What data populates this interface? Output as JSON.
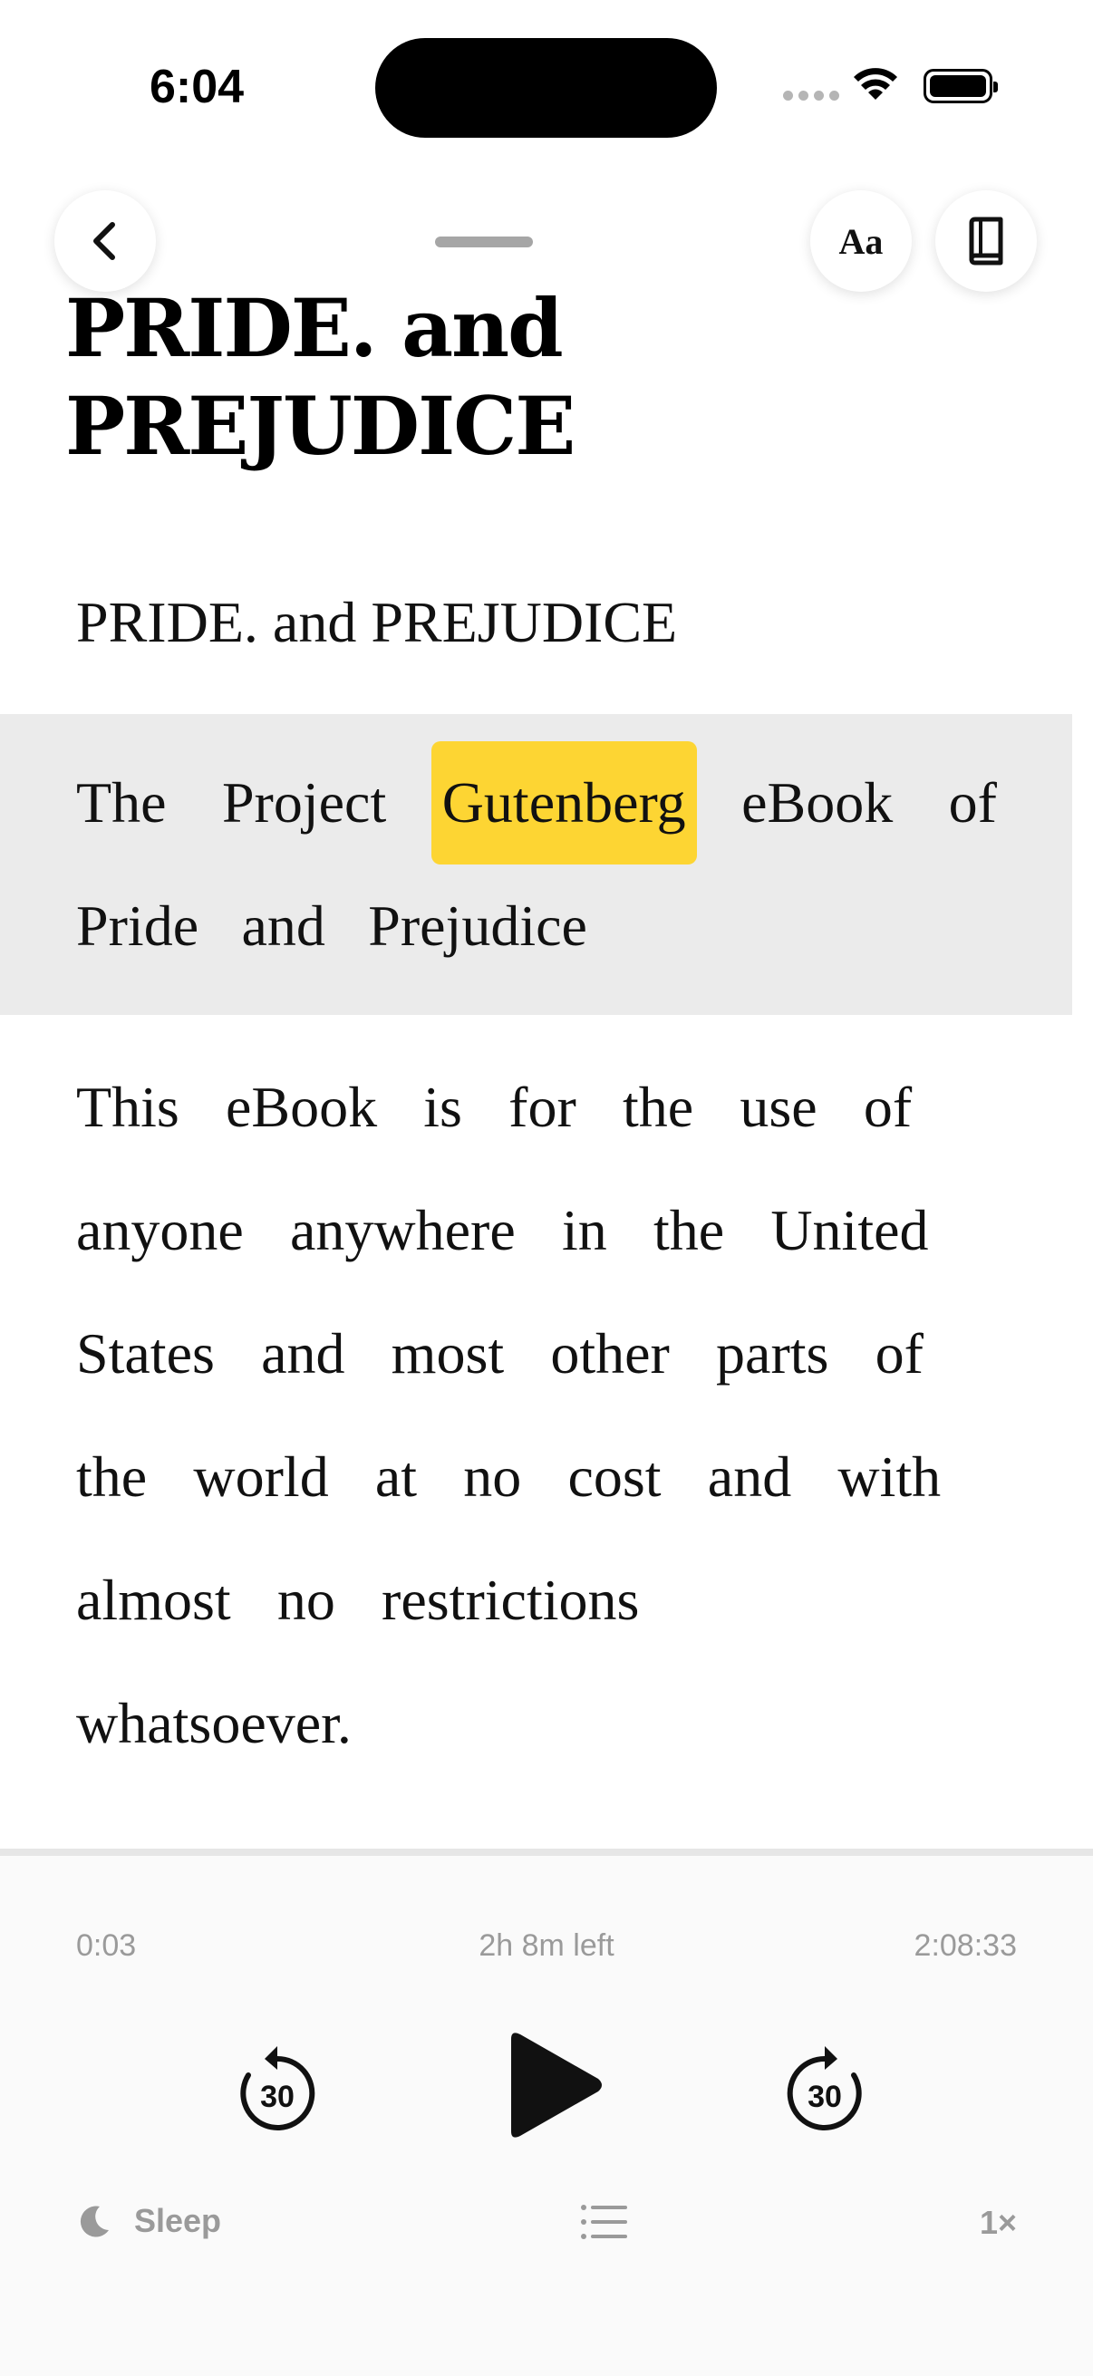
{
  "status_bar": {
    "time": "6:04"
  },
  "header": {
    "font_button_label": "Aa"
  },
  "book": {
    "title_line1": "PRIDE. and",
    "title_line2": "PREJUDICE",
    "chapter_title": "PRIDE. and PREJUDICE"
  },
  "paragraph1": {
    "words_line1": [
      "The",
      "Project",
      "Gutenberg",
      "eBook",
      "of"
    ],
    "highlighted_word": "Gutenberg",
    "line2": "Pride  and  Prejudice"
  },
  "paragraph2": {
    "lines": [
      "This eBook is for the use of",
      "anyone anywhere in the United",
      "States and most other parts of",
      "the world at no cost and with",
      "almost no restrictions",
      "whatsoever."
    ]
  },
  "player": {
    "elapsed": "0:03",
    "remaining": "2h 8m left",
    "total": "2:08:33",
    "skip_back_seconds": "30",
    "skip_forward_seconds": "30",
    "sleep_label": "Sleep",
    "speed_label": "1×"
  },
  "colors": {
    "highlight": "#fdd533",
    "active_block": "#ebebeb",
    "muted_text": "#9a9a9a"
  },
  "icons": [
    "back-chevron-icon",
    "font-settings-icon",
    "book-icon",
    "rewind-30-icon",
    "play-icon",
    "forward-30-icon",
    "moon-icon",
    "chapter-list-icon"
  ]
}
